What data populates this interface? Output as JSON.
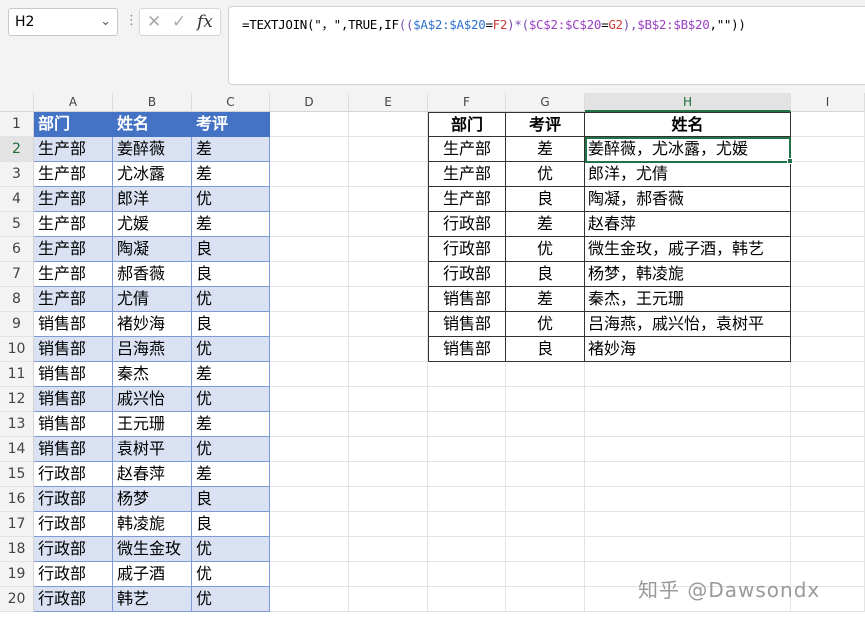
{
  "name_box": "H2",
  "formula_bar": {
    "cancel_icon": "close-icon",
    "enter_icon": "check-icon",
    "fx_label": "fx",
    "parts": [
      {
        "t": "=TEXTJOIN(\"，\",TRUE,IF",
        "c": "plain"
      },
      {
        "t": "((",
        "c": "paren"
      },
      {
        "t": "$A$2:$A$20",
        "c": "blue"
      },
      {
        "t": "=",
        "c": "plain"
      },
      {
        "t": "F2",
        "c": "red"
      },
      {
        "t": ")*(",
        "c": "paren"
      },
      {
        "t": "$C$2:$C$20",
        "c": "purple"
      },
      {
        "t": "=",
        "c": "plain"
      },
      {
        "t": "G2",
        "c": "red"
      },
      {
        "t": "),",
        "c": "paren"
      },
      {
        "t": "$B$2:$B$20",
        "c": "purple"
      },
      {
        "t": ",\"\"))",
        "c": "plain"
      }
    ]
  },
  "columns": [
    "A",
    "B",
    "C",
    "D",
    "E",
    "F",
    "G",
    "H",
    "I"
  ],
  "selected_column": "H",
  "rows": [
    "1",
    "2",
    "3",
    "4",
    "5",
    "6",
    "7",
    "8",
    "9",
    "10",
    "11",
    "12",
    "13",
    "14",
    "15",
    "16",
    "17",
    "18",
    "19",
    "20"
  ],
  "selected_row": "2",
  "source_table": {
    "headers": [
      "部门",
      "姓名",
      "考评"
    ],
    "rows": [
      [
        "生产部",
        "姜醉薇",
        "差"
      ],
      [
        "生产部",
        "尤冰露",
        "差"
      ],
      [
        "生产部",
        "郎洋",
        "优"
      ],
      [
        "生产部",
        "尤媛",
        "差"
      ],
      [
        "生产部",
        "陶凝",
        "良"
      ],
      [
        "生产部",
        "郝香薇",
        "良"
      ],
      [
        "生产部",
        "尤倩",
        "优"
      ],
      [
        "销售部",
        "褚妙海",
        "良"
      ],
      [
        "销售部",
        "吕海燕",
        "优"
      ],
      [
        "销售部",
        "秦杰",
        "差"
      ],
      [
        "销售部",
        "戚兴怡",
        "优"
      ],
      [
        "销售部",
        "王元珊",
        "差"
      ],
      [
        "销售部",
        "袁树平",
        "优"
      ],
      [
        "行政部",
        "赵春萍",
        "差"
      ],
      [
        "行政部",
        "杨梦",
        "良"
      ],
      [
        "行政部",
        "韩凌旎",
        "良"
      ],
      [
        "行政部",
        "微生金玫",
        "优"
      ],
      [
        "行政部",
        "戚子酒",
        "优"
      ],
      [
        "行政部",
        "韩艺",
        "优"
      ]
    ]
  },
  "result_table": {
    "headers": [
      "部门",
      "考评",
      "姓名"
    ],
    "rows": [
      [
        "生产部",
        "差",
        "姜醉薇，尤冰露，尤媛"
      ],
      [
        "生产部",
        "优",
        "郎洋，尤倩"
      ],
      [
        "生产部",
        "良",
        "陶凝，郝香薇"
      ],
      [
        "行政部",
        "差",
        "赵春萍"
      ],
      [
        "行政部",
        "优",
        "微生金玫，戚子酒，韩艺"
      ],
      [
        "行政部",
        "良",
        "杨梦，韩凌旎"
      ],
      [
        "销售部",
        "差",
        "秦杰，王元珊"
      ],
      [
        "销售部",
        "优",
        "吕海燕，戚兴怡，袁树平"
      ],
      [
        "销售部",
        "良",
        "褚妙海"
      ]
    ]
  },
  "watermark": "知乎 @Dawsondx"
}
